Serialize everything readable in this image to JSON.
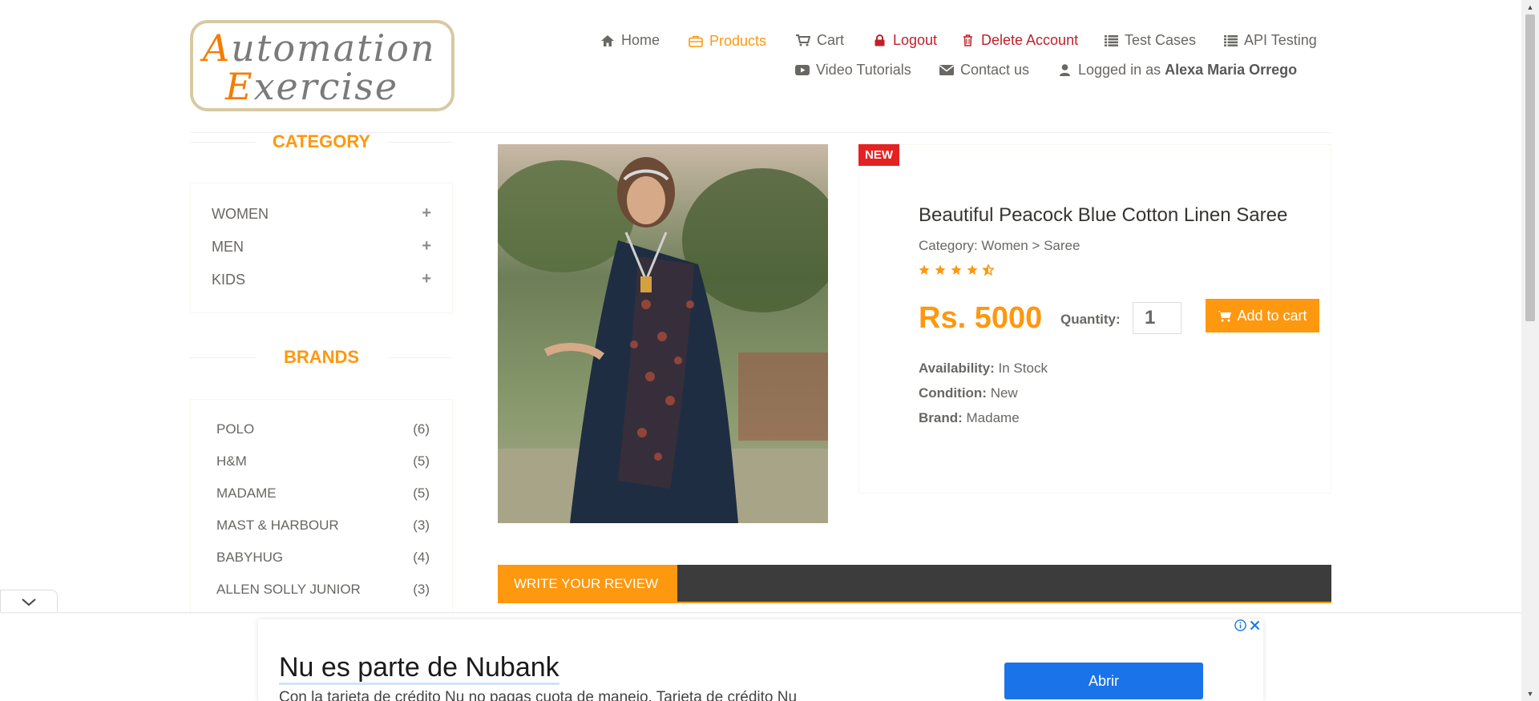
{
  "logo": {
    "line1_first": "A",
    "line1_rest": "utomation",
    "line2_first": "E",
    "line2_rest": "xercise",
    "alt": "Automation Exercise"
  },
  "nav": {
    "home": "Home",
    "products": "Products",
    "cart": "Cart",
    "logout": "Logout",
    "delete_account": "Delete Account",
    "test_cases": "Test Cases",
    "api_testing": "API Testing",
    "video_tutorials": "Video Tutorials",
    "contact_us": "Contact us",
    "logged_in_prefix": "Logged in as",
    "logged_in_user": "Alexa Maria Orrego"
  },
  "sidebar": {
    "category_title": "CATEGORY",
    "categories": [
      {
        "label": "WOMEN",
        "toggle": "+"
      },
      {
        "label": "MEN",
        "toggle": "+"
      },
      {
        "label": "KIDS",
        "toggle": "+"
      }
    ],
    "brands_title": "BRANDS",
    "brands": [
      {
        "name": "POLO",
        "count": "(6)"
      },
      {
        "name": "H&M",
        "count": "(5)"
      },
      {
        "name": "MADAME",
        "count": "(5)"
      },
      {
        "name": "MAST & HARBOUR",
        "count": "(3)"
      },
      {
        "name": "BABYHUG",
        "count": "(4)"
      },
      {
        "name": "ALLEN SOLLY JUNIOR",
        "count": "(3)"
      }
    ]
  },
  "product": {
    "badge": "NEW",
    "name": "Beautiful Peacock Blue Cotton Linen Saree",
    "category": "Category: Women > Saree",
    "rating": 4.5,
    "price": "Rs. 5000",
    "quantity_label": "Quantity:",
    "quantity_value": "1",
    "add_to_cart": "Add to cart",
    "availability_label": "Availability:",
    "availability": "In Stock",
    "condition_label": "Condition:",
    "condition": "New",
    "brand_label": "Brand:",
    "brand": "Madame"
  },
  "review": {
    "tab_label": "WRITE YOUR REVIEW"
  },
  "ad": {
    "title": "Nu es parte de Nubank",
    "text": "Con la tarjeta de crédito Nu no pagas cuota de manejo. Tarjeta de crédito Nu",
    "button": "Abrir"
  },
  "colors": {
    "accent": "#fe980f",
    "danger": "#c0202a",
    "badge": "#e52222",
    "dark_bar": "#3c3c3c",
    "ad_button": "#1a73e8"
  }
}
